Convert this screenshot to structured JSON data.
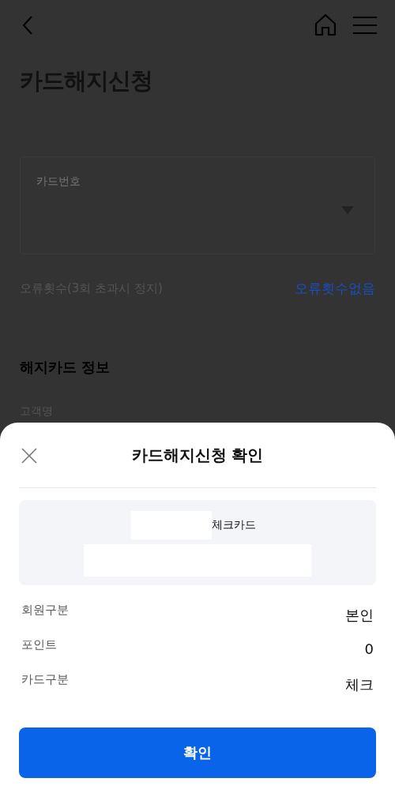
{
  "page": {
    "title": "카드해지신청",
    "card_number_field": {
      "label": "카드번호"
    },
    "error_count": {
      "label": "오류횟수(3회 초과시 정지)",
      "value": "오류횟수없음"
    },
    "section": {
      "title": "해지카드 정보",
      "first_label": "고객명"
    }
  },
  "dialog": {
    "title": "카드해지신청 확인",
    "card_name": "체크카드",
    "details": [
      {
        "label": "회원구분",
        "value": "본인"
      },
      {
        "label": "포인트",
        "value": "0"
      },
      {
        "label": "카드구분",
        "value": "체크"
      }
    ],
    "confirm_button": "확인"
  }
}
